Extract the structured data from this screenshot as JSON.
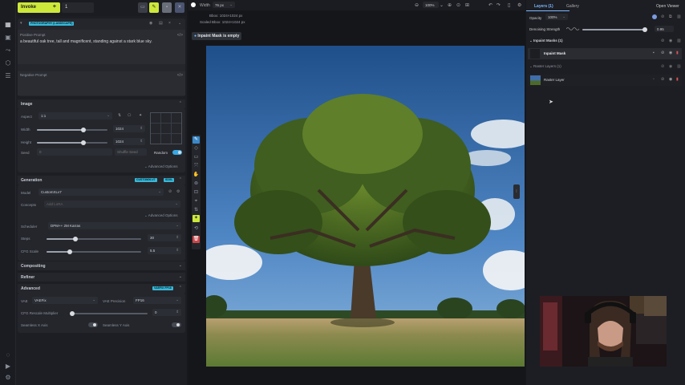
{
  "topbar": {
    "invoke_label": "Invoke",
    "quantity": "1"
  },
  "prompts": {
    "style_badge": "PHOTOGRAPHY (LANDSCAPE)",
    "positive_label": "Positive Prompt",
    "positive_text": "a beautiful oak tree, tall and magnificent, standing against a stark blue sky.",
    "negative_label": "Negative Prompt"
  },
  "image_section": {
    "title": "Image",
    "aspect_label": "Aspect",
    "aspect_value": "1:1",
    "width_label": "Width",
    "width_value": "1024",
    "height_label": "Height",
    "height_value": "1024",
    "seed_label": "Seed",
    "seed_value": "0",
    "shuffle_label": "Shuffle Seed",
    "random_label": "Random",
    "advanced_label": "Advanced Options"
  },
  "generation": {
    "title": "Generation",
    "badge1": "CUSTOMXLV7",
    "badge2": "SDXL",
    "model_label": "Model",
    "model_value": "CustomXLv7",
    "concepts_label": "Concepts",
    "concepts_placeholder": "Add LoRA",
    "advanced_label": "Advanced Options",
    "scheduler_label": "Scheduler",
    "scheduler_value": "DPM++ 2M Karras",
    "steps_label": "Steps",
    "steps_value": "30",
    "cfg_label": "CFG Scale",
    "cfg_value": "5.5"
  },
  "sections": {
    "compositing": "Compositing",
    "refiner": "Refiner",
    "advanced": "Advanced",
    "advanced_badge": "VAEFIX FP16"
  },
  "advanced": {
    "vae_label": "VAE",
    "vae_value": "VAEFix",
    "vae_precision_label": "VAE Precision",
    "vae_precision_value": "FP16",
    "cfg_rescale_label": "CFG Rescale Multiplier",
    "cfg_rescale_value": "0",
    "seamless_x": "Seamless X Axis",
    "seamless_y": "Seamless Y Axis"
  },
  "canvas": {
    "width_label": "Width",
    "width_value": "76 px",
    "bbox_label": "Bbox:",
    "bbox_value": "1024×1024 px",
    "scaled_label": "Scaled Bbox:",
    "scaled_value": "1024×1024 px",
    "mask_notice": "Inpaint Mask is empty",
    "zoom_value": "100%"
  },
  "right": {
    "tab_layers": "Layers (1)",
    "tab_gallery": "Gallery",
    "open_viewer": "Open Viewer",
    "opacity_label": "Opacity",
    "opacity_value": "100%",
    "denoise_label": "Denoising Strength",
    "denoise_value": "0.95",
    "inpaint_masks_header": "Inpaint Masks (1)",
    "inpaint_mask_name": "Inpaint Mask",
    "raster_layers_header": "Raster Layers (1)",
    "raster_layer_name": "Raster Layer"
  },
  "colors": {
    "accent": "#cde83a",
    "badge": "#3ab8d8",
    "panel": "#1d1e23"
  }
}
